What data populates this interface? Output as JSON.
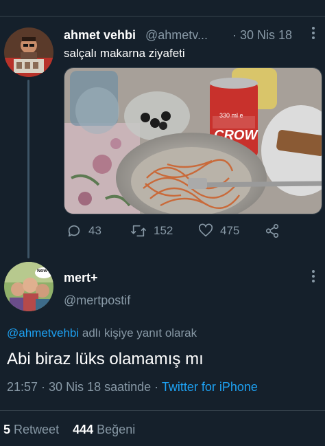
{
  "thread_tweet": {
    "author_name": "ahmet vehbi",
    "author_handle": "@ahmetv...",
    "date": "· 30 Nis 18",
    "text": "salçalı makarna ziyafeti",
    "media": {
      "can_label": "CROW",
      "can_volume": "330 ml e"
    },
    "actions": {
      "replies": "43",
      "retweets": "152",
      "likes": "475"
    }
  },
  "focused_tweet": {
    "author_name": "mert+",
    "author_handle": "@mertpostif",
    "avatar_badge": "Now p",
    "reply_to_handle": "@ahmetvehbi",
    "reply_to_suffix": " adlı kişiye yanıt olarak",
    "text": "Abi biraz lüks olamamış mı",
    "time": "21:57 · 30 Nis 18 saatinde · ",
    "source": "Twitter for iPhone",
    "retweet_count": "5",
    "retweet_label": "Retweet",
    "like_count": "444",
    "like_label": "Beğeni"
  },
  "colors": {
    "background": "#15202b",
    "muted": "#8899a6",
    "link": "#1da1f2",
    "divider": "#38444d"
  }
}
